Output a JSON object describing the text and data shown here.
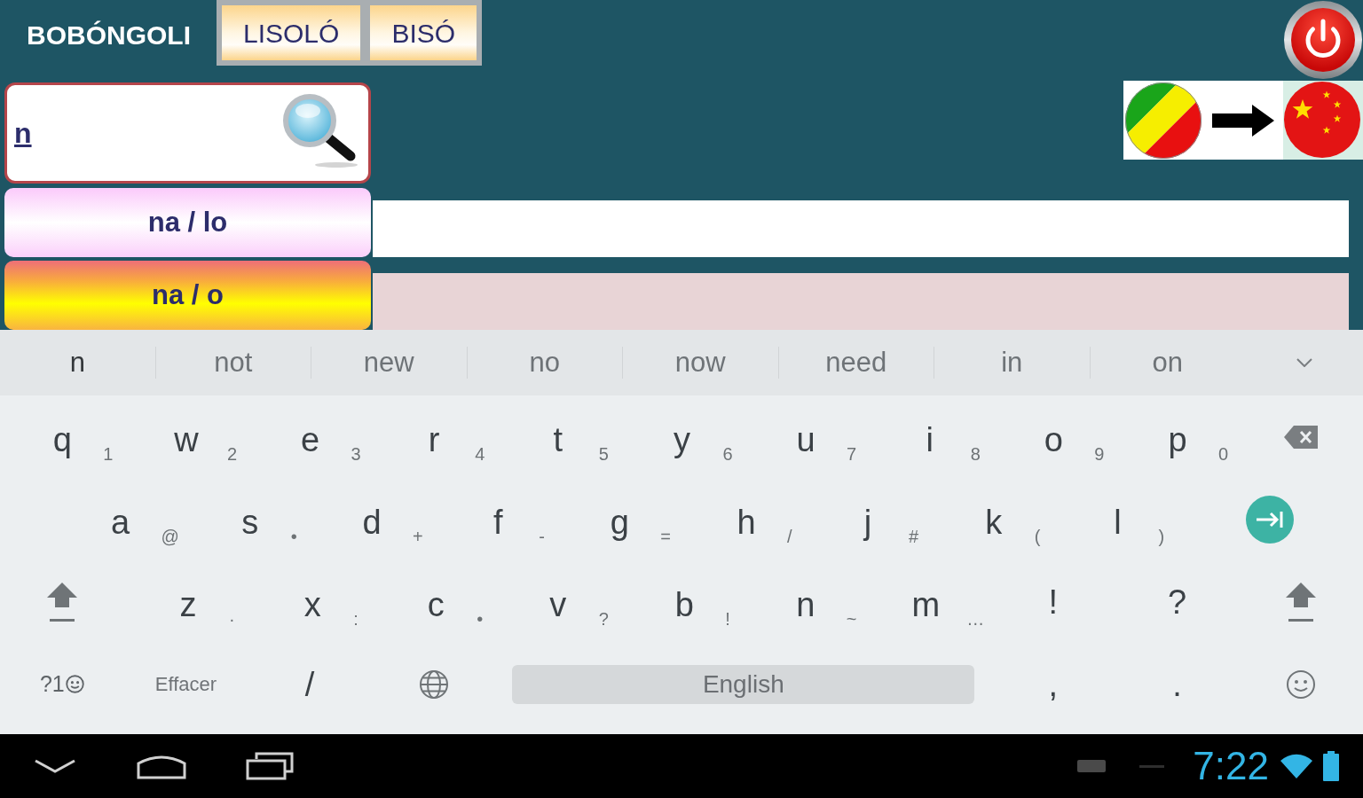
{
  "header": {
    "title": "BOBÓNGOLI",
    "buttons": [
      "LISOLÓ",
      "BISÓ"
    ]
  },
  "search": {
    "value": "n"
  },
  "results": [
    {
      "text": "na / lo",
      "selected": false
    },
    {
      "text": "na / o",
      "selected": true
    }
  ],
  "keyboard": {
    "suggestions": [
      {
        "text": "n",
        "typed": true
      },
      {
        "text": "not",
        "typed": false
      },
      {
        "text": "new",
        "typed": false
      },
      {
        "text": "no",
        "typed": false
      },
      {
        "text": "now",
        "typed": false
      },
      {
        "text": "need",
        "typed": false
      },
      {
        "text": "in",
        "typed": false
      },
      {
        "text": "on",
        "typed": false
      }
    ],
    "rows": [
      [
        {
          "kind": "char",
          "label": "q",
          "hint": "1"
        },
        {
          "kind": "char",
          "label": "w",
          "hint": "2"
        },
        {
          "kind": "char",
          "label": "e",
          "hint": "3"
        },
        {
          "kind": "char",
          "label": "r",
          "hint": "4"
        },
        {
          "kind": "char",
          "label": "t",
          "hint": "5"
        },
        {
          "kind": "char",
          "label": "y",
          "hint": "6"
        },
        {
          "kind": "char",
          "label": "u",
          "hint": "7"
        },
        {
          "kind": "char",
          "label": "i",
          "hint": "8"
        },
        {
          "kind": "char",
          "label": "o",
          "hint": "9"
        },
        {
          "kind": "char",
          "label": "p",
          "hint": "0"
        },
        {
          "kind": "backspace"
        }
      ],
      [
        {
          "kind": "char",
          "label": "a",
          "hint": "@"
        },
        {
          "kind": "char",
          "label": "s",
          "hint": "•"
        },
        {
          "kind": "char",
          "label": "d",
          "hint": "+"
        },
        {
          "kind": "char",
          "label": "f",
          "hint": "-"
        },
        {
          "kind": "char",
          "label": "g",
          "hint": "="
        },
        {
          "kind": "char",
          "label": "h",
          "hint": "/"
        },
        {
          "kind": "char",
          "label": "j",
          "hint": "#"
        },
        {
          "kind": "char",
          "label": "k",
          "hint": "("
        },
        {
          "kind": "char",
          "label": "l",
          "hint": ")"
        },
        {
          "kind": "tab"
        }
      ],
      [
        {
          "kind": "shift"
        },
        {
          "kind": "char",
          "label": "z",
          "hint": "·"
        },
        {
          "kind": "char",
          "label": "x",
          "hint": ":"
        },
        {
          "kind": "char",
          "label": "c",
          "hint": "•"
        },
        {
          "kind": "char",
          "label": "v",
          "hint": "?"
        },
        {
          "kind": "char",
          "label": "b",
          "hint": "!"
        },
        {
          "kind": "char",
          "label": "n",
          "hint": "~"
        },
        {
          "kind": "char",
          "label": "m",
          "hint": "…"
        },
        {
          "kind": "char",
          "label": "!"
        },
        {
          "kind": "char",
          "label": "?"
        },
        {
          "kind": "shift"
        }
      ],
      [
        {
          "kind": "symbols",
          "label": "?1"
        },
        {
          "kind": "text",
          "label": "Effacer"
        },
        {
          "kind": "char",
          "label": "/"
        },
        {
          "kind": "globe"
        },
        {
          "kind": "space",
          "label": "English"
        },
        "",
        "",
        "",
        {
          "kind": "char",
          "label": ","
        },
        {
          "kind": "char",
          "label": "."
        },
        {
          "kind": "emoji"
        }
      ]
    ]
  },
  "status_bar": {
    "time": "7:22"
  }
}
